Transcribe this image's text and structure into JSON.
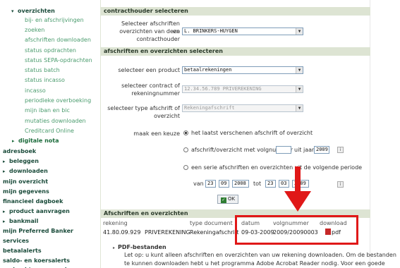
{
  "sidebar": {
    "items": [
      {
        "label": "overzichten",
        "arrow": "▾"
      },
      {
        "label": "bij- en afschrijvingen"
      },
      {
        "label": "zoeken"
      },
      {
        "label": "afschriften downloaden"
      },
      {
        "label": "status opdrachten"
      },
      {
        "label": "status SEPA-opdrachten"
      },
      {
        "label": "status batch"
      },
      {
        "label": "status incasso"
      },
      {
        "label": "incasso"
      },
      {
        "label": "periodieke overboeking"
      },
      {
        "label": "mijn iban en bic"
      },
      {
        "label": "mutaties downloaden"
      },
      {
        "label": "Creditcard Online"
      },
      {
        "label": "digitale nota",
        "arrow": "▸"
      },
      {
        "label": "adresboek"
      },
      {
        "label": "beleggen",
        "arrow": "▸"
      },
      {
        "label": "downloaden",
        "arrow": "▸"
      },
      {
        "label": "mijn overzicht"
      },
      {
        "label": "mijn gegevens"
      },
      {
        "label": "financieel dagboek"
      },
      {
        "label": "product aanvragen",
        "arrow": "▸"
      },
      {
        "label": "bankmail",
        "arrow": "▸"
      },
      {
        "label": "mijn Preferred Banker"
      },
      {
        "label": "services"
      },
      {
        "label": "betaalalerts"
      },
      {
        "label": "saldo- en koersalerts"
      },
      {
        "label": "opdrachten verzenden"
      }
    ]
  },
  "section1": {
    "title": "contracthouder selecteren",
    "label_line1": "Selecteer afschriften en",
    "label_line2": "overzichten van deze",
    "label_line3": "contracthouder",
    "value": "L. BRINKERS-HUYGEN"
  },
  "section2": {
    "title": "afschriften en overzichten selecteren",
    "product_label": "selecteer een product",
    "product_value": "betaalrekeningen",
    "contract_label_line1": "selecteer contract of",
    "contract_label_line2": "rekeningnummer",
    "contract_value": "12.34.56.789  PRIVEREKENING",
    "type_label_line1": "selecteer type afschrift of",
    "type_label_line2": "overzicht",
    "type_value": "Rekeningafschrift",
    "choice_label": "maak een keuze",
    "opt1": "het laatst verschenen afschrift of overzicht",
    "opt2_prefix": "afschrift/overzicht met volgnummer",
    "opt2_mid": "uit jaar",
    "opt2_year": "2009",
    "opt3": "een serie afschriften en overzichten uit de volgende periode",
    "van_label": "van",
    "tot_label": "tot",
    "from_d": "23",
    "from_m": "09",
    "from_y": "2008",
    "to_d": "23",
    "to_m": "03",
    "to_y": "2009",
    "ok_label": "OK",
    "help_glyph": "i"
  },
  "results": {
    "title": "Afschriften en overzichten",
    "headers": {
      "account": "rekening",
      "type": "type document",
      "date": "datum",
      "seq": "volgnummer",
      "download": "download"
    },
    "rows": [
      {
        "account": "41.80.09.929",
        "account_name": "PRIVEREKENING",
        "type": "Rekeningafschrift",
        "date": "09-03-2009",
        "seq": "2009/20090003",
        "download": "pdf"
      }
    ]
  },
  "pdf_info": {
    "title": "PDF-bestanden",
    "line1": "Let op: u kunt alleen afschriften en overzichten van uw rekening downloaden. Om de bestanden",
    "line2": "te kunnen downloaden hebt u het programma Adobe Acrobat Reader nodig. Voor een goede"
  },
  "colors": {
    "highlight": "#e01818",
    "band": "#dde4d3",
    "nav": "#4b9c6e"
  }
}
